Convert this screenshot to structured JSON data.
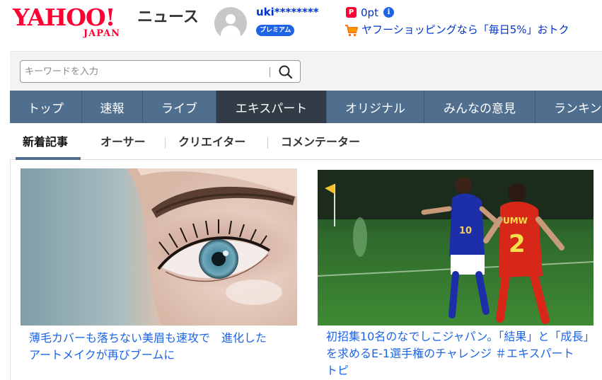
{
  "header": {
    "logo_main": "YAHOO!",
    "logo_sub": "JAPAN",
    "service_name": "ニュース",
    "username": "uki********",
    "premium_badge": "プレミアム",
    "paypay_icon": "P",
    "points": "0pt",
    "info_icon": "i",
    "shopping_link": "ヤフーショッピングなら「毎日5%」おトク",
    "colors": {
      "brand": "#ff0033",
      "link": "#0033cc",
      "badge": "#1e64e6"
    }
  },
  "search": {
    "placeholder": "キーワードを入力",
    "value": "",
    "icon": "search-icon"
  },
  "nav": {
    "items": [
      {
        "label": "トップ",
        "active": false
      },
      {
        "label": "速報",
        "active": false
      },
      {
        "label": "ライブ",
        "active": false
      },
      {
        "label": "エキスパート",
        "active": true
      },
      {
        "label": "オリジナル",
        "active": false
      },
      {
        "label": "みんなの意見",
        "active": false
      },
      {
        "label": "ランキング",
        "active": false
      }
    ],
    "colors": {
      "bar": "#506f8f",
      "active": "#333b47"
    }
  },
  "sub_tabs": {
    "items": [
      {
        "label": "新着記事",
        "active": true
      },
      {
        "label": "オーサー",
        "active": false
      },
      {
        "label": "クリエイター",
        "active": false
      },
      {
        "label": "コメンテーター",
        "active": false
      }
    ]
  },
  "articles": [
    {
      "title_line1": "薄毛カバーも落ちない美眉も速攻で　進化した",
      "title_line2": "アートメイクが再びブームに",
      "title_line3": "",
      "image": "eye-closeup-photo"
    },
    {
      "title_line1": "初招集10名のなでしこジャパン。「結果」と「成長」",
      "title_line2": "を求めるE-1選手権のチャレンジ ＃エキスパート",
      "title_line3": "トピ",
      "image": "womens-football-photo",
      "jersey_left": "10",
      "jersey_right_name": "UMW",
      "jersey_right_number": "2"
    }
  ]
}
